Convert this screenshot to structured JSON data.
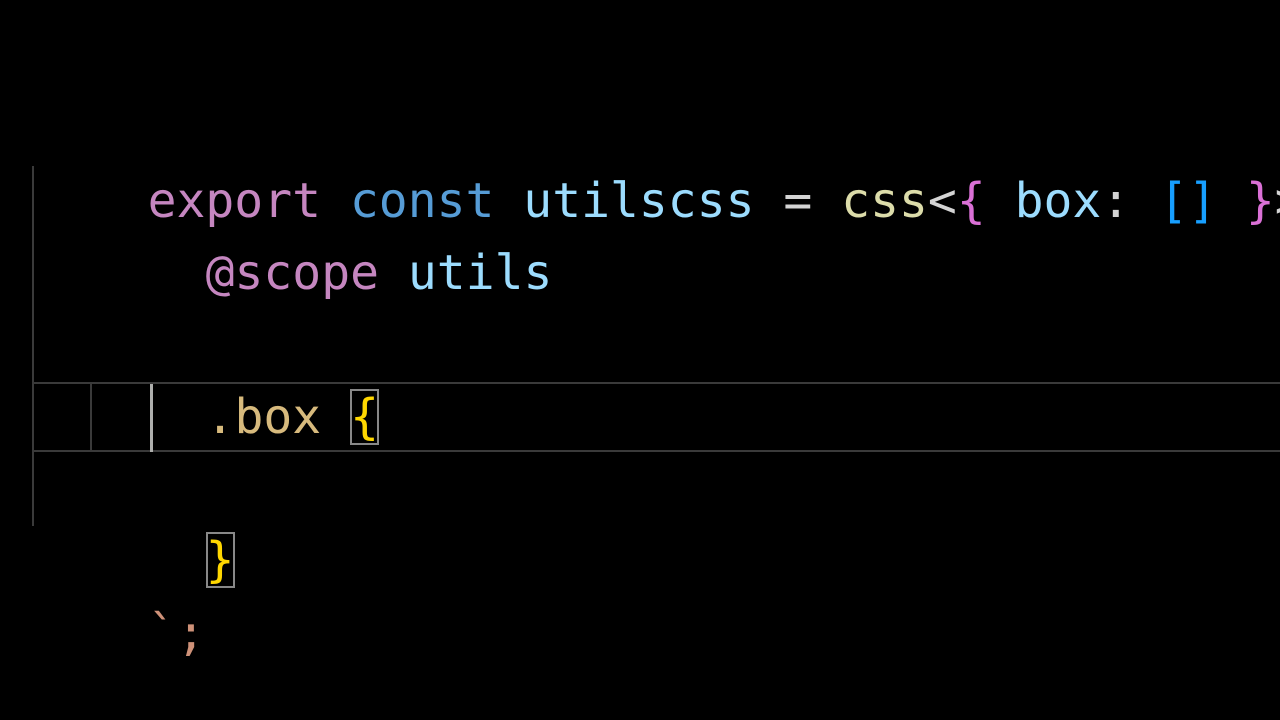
{
  "colors": {
    "background": "#000000",
    "keyword_export": "#c586c0",
    "keyword_const": "#569cd6",
    "variable": "#9cdcfe",
    "operator": "#d4d4d4",
    "function": "#dcdcaa",
    "bracket_level1": "#ffd700",
    "bracket_level2": "#da70d6",
    "bracket_level3": "#179fff",
    "at_rule": "#c586c0",
    "selector": "#d7ba7d",
    "template": "#ce9178"
  },
  "editor": {
    "line1": {
      "export_kw": "export",
      "const_kw": "const",
      "var_name": "utilscss",
      "equals": "=",
      "func_name": "css",
      "lt": "<",
      "brace_open": "{",
      "prop": "box",
      "colon": ":",
      "bracket_pair": "[]",
      "brace_close": "}",
      "gt": ">",
      "backtick": "`"
    },
    "line2": {
      "at_scope": "@scope",
      "scope_name": "utils"
    },
    "line4": {
      "selector": ".box",
      "brace_open": "{"
    },
    "line6": {
      "brace_close": "}"
    },
    "line7": {
      "closing": "`;"
    }
  }
}
